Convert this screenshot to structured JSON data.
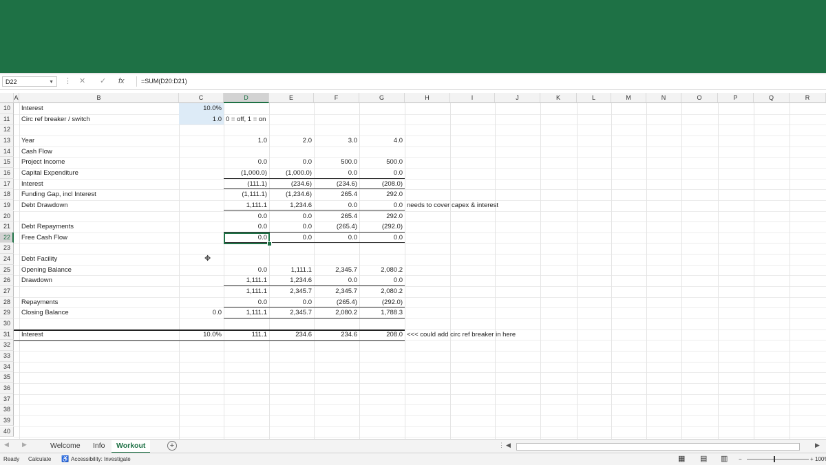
{
  "formula_bar": {
    "name_box": "D22",
    "formula": "=SUM(D20:D21)"
  },
  "columns": [
    "A",
    "B",
    "C",
    "D",
    "E",
    "F",
    "G",
    "H",
    "I",
    "J",
    "K",
    "L",
    "M",
    "N",
    "O",
    "P",
    "Q",
    "R"
  ],
  "rows": [
    "10",
    "11",
    "12",
    "13",
    "14",
    "15",
    "16",
    "17",
    "18",
    "19",
    "20",
    "21",
    "22",
    "23",
    "24",
    "25",
    "26",
    "27",
    "28",
    "29",
    "30",
    "31",
    "32",
    "33",
    "34",
    "35",
    "36",
    "37",
    "38",
    "39",
    "40"
  ],
  "cells": {
    "B10": "Interest",
    "C10": "10.0%",
    "B11": "Circ ref breaker / switch",
    "C11": "1.0",
    "D11": "0 = off, 1 = on",
    "B13": "Year",
    "D13": "1.0",
    "E13": "2.0",
    "F13": "3.0",
    "G13": "4.0",
    "B14": "Cash Flow",
    "B15": "Project Income",
    "D15": "0.0",
    "E15": "0.0",
    "F15": "500.0",
    "G15": "500.0",
    "B16": "Capital Expenditure",
    "D16": "(1,000.0)",
    "E16": "(1,000.0)",
    "F16": "0.0",
    "G16": "0.0",
    "B17": "Interest",
    "D17": "(111.1)",
    "E17": "(234.6)",
    "F17": "(234.6)",
    "G17": "(208.0)",
    "B18": "Funding Gap, incl Interest",
    "D18": "(1,111.1)",
    "E18": "(1,234.6)",
    "F18": "265.4",
    "G18": "292.0",
    "B19": "Debt Drawdown",
    "D19": "1,111.1",
    "E19": "1,234.6",
    "F19": "0.0",
    "G19": "0.0",
    "H19": "needs to cover capex & interest",
    "D20": "0.0",
    "E20": "0.0",
    "F20": "265.4",
    "G20": "292.0",
    "B21": "Debt Repayments",
    "D21": "0.0",
    "E21": "0.0",
    "F21": "(265.4)",
    "G21": "(292.0)",
    "B22": "Free Cash Flow",
    "D22": "0.0",
    "E22": "0.0",
    "F22": "0.0",
    "G22": "0.0",
    "B24": "Debt Facility",
    "B25": "Opening Balance",
    "D25": "0.0",
    "E25": "1,111.1",
    "F25": "2,345.7",
    "G25": "2,080.2",
    "B26": "Drawdown",
    "D26": "1,111.1",
    "E26": "1,234.6",
    "F26": "0.0",
    "G26": "0.0",
    "D27": "1,111.1",
    "E27": "2,345.7",
    "F27": "2,345.7",
    "G27": "2,080.2",
    "B28": "Repayments",
    "D28": "0.0",
    "E28": "0.0",
    "F28": "(265.4)",
    "G28": "(292.0)",
    "B29": "Closing Balance",
    "C29": "0.0",
    "D29": "1,111.1",
    "E29": "2,345.7",
    "F29": "2,080.2",
    "G29": "1,788.3",
    "B31": "Interest",
    "C31": "10.0%",
    "D31": "111.1",
    "E31": "234.6",
    "F31": "234.6",
    "G31": "208.0",
    "H31": "<<< could add circ ref breaker in here"
  },
  "sheet_tabs": [
    "Welcome",
    "Info",
    "Workout"
  ],
  "active_tab": "Workout",
  "status": {
    "ready": "Ready",
    "calculate": "Calculate",
    "accessibility": "Accessibility: Investigate",
    "zoom": "100%"
  },
  "colors": {
    "ribbon": "#1e7145",
    "accent": "#1e7145",
    "input_fill": "#ddebf7"
  }
}
